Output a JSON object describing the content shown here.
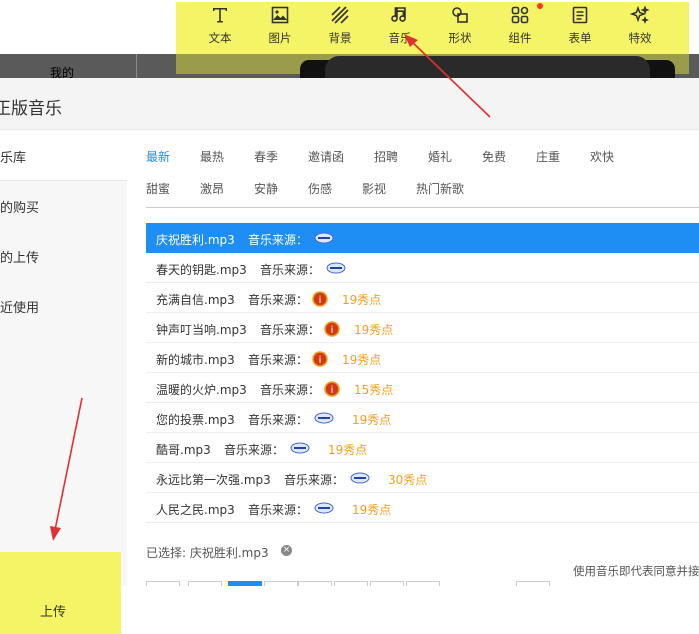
{
  "toolbar": {
    "tools": [
      {
        "label": "文本",
        "icon": "text-icon"
      },
      {
        "label": "图片",
        "icon": "image-icon"
      },
      {
        "label": "背景",
        "icon": "background-icon"
      },
      {
        "label": "音乐",
        "icon": "music-icon"
      },
      {
        "label": "形状",
        "icon": "shape-icon"
      },
      {
        "label": "组件",
        "icon": "component-icon"
      },
      {
        "label": "表单",
        "icon": "form-icon"
      },
      {
        "label": "特效",
        "icon": "effects-icon"
      }
    ]
  },
  "background": {
    "mine_label": "我的"
  },
  "dialog": {
    "title": "正版音乐",
    "sidebar": [
      {
        "label": "乐库"
      },
      {
        "label": "的购买"
      },
      {
        "label": "的上传"
      },
      {
        "label": "近使用"
      }
    ],
    "upload_label": "上传",
    "categories_row1": [
      "最新",
      "最热",
      "春季",
      "邀请函",
      "招聘",
      "婚礼",
      "免费",
      "庄重",
      "欢快"
    ],
    "categories_row2": [
      "甜蜜",
      "激昂",
      "安静",
      "伤感",
      "影视",
      "热门新歌"
    ],
    "source_label": "音乐来源：",
    "songs": [
      {
        "name": "庆祝胜利.mp3",
        "points": ""
      },
      {
        "name": "春天的钥匙.mp3",
        "points": ""
      },
      {
        "name": "充满自信.mp3",
        "points": "19秀点"
      },
      {
        "name": "钟声叮当响.mp3",
        "points": "19秀点"
      },
      {
        "name": "新的城市.mp3",
        "points": "19秀点"
      },
      {
        "name": "温暖的火炉.mp3",
        "points": "15秀点"
      },
      {
        "name": "您的投票.mp3",
        "points": "19秀点"
      },
      {
        "name": "酷哥.mp3",
        "points": "19秀点"
      },
      {
        "name": "永远比第一次强.mp3",
        "points": "30秀点"
      },
      {
        "name": "人民之民.mp3",
        "points": "19秀点"
      }
    ],
    "selected_text": "已选择: 庆祝胜利.mp3",
    "notice": "使用音乐即代表同意并接"
  },
  "colors": {
    "accent": "#1e8ef5",
    "highlight": "#f4f466",
    "points": "#f0a020"
  }
}
